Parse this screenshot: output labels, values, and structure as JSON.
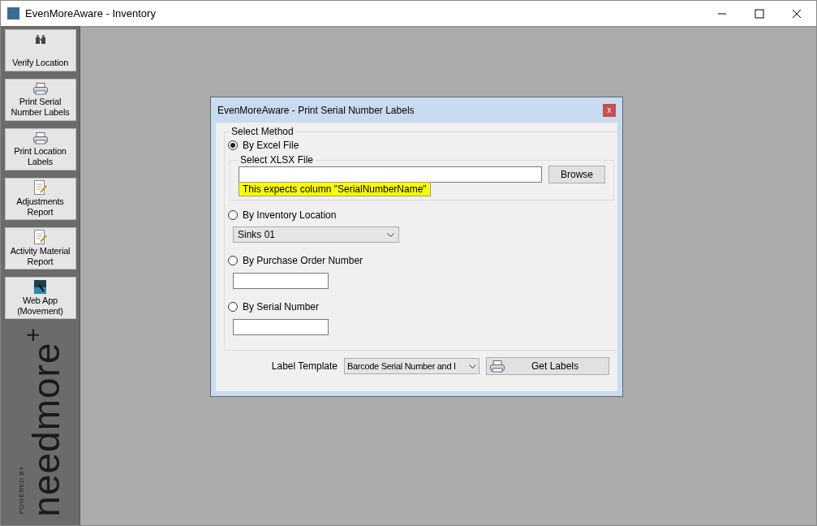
{
  "window": {
    "title": "EvenMoreAware - Inventory"
  },
  "sidebar": {
    "items": [
      {
        "label": "Verify Location",
        "kind": "binoculars"
      },
      {
        "label": "Print Serial Number Labels",
        "kind": "printer"
      },
      {
        "label": "Print Location Labels",
        "kind": "printer"
      },
      {
        "label": "Adjustments Report",
        "kind": "report"
      },
      {
        "label": "Activity Material Report",
        "kind": "report"
      },
      {
        "label": "Web App (Movement)",
        "kind": "app"
      }
    ],
    "logo": {
      "powered_by": "POWERED BY",
      "brand": "needmore",
      "mark": "+"
    }
  },
  "dialog": {
    "title": "EvenMoreAware - Print Serial Number Labels",
    "close": "x",
    "group_title": "Select Method",
    "methods": [
      {
        "label": "By Excel File",
        "selected": true,
        "kind": "file"
      },
      {
        "label": "By Inventory Location",
        "selected": false,
        "kind": "dropdown",
        "value": "Sinks 01"
      },
      {
        "label": "By Purchase Order Number",
        "selected": false,
        "kind": "text"
      },
      {
        "label": "By Serial Number",
        "selected": false,
        "kind": "text"
      }
    ],
    "file_group": {
      "title": "Select XLSX File",
      "button": "Browse",
      "hint": "This expects column \"SerialNumberName\""
    },
    "template_label": "Label Template",
    "template_value": "Barcode Serial Number and I",
    "get_labels": "Get Labels"
  }
}
